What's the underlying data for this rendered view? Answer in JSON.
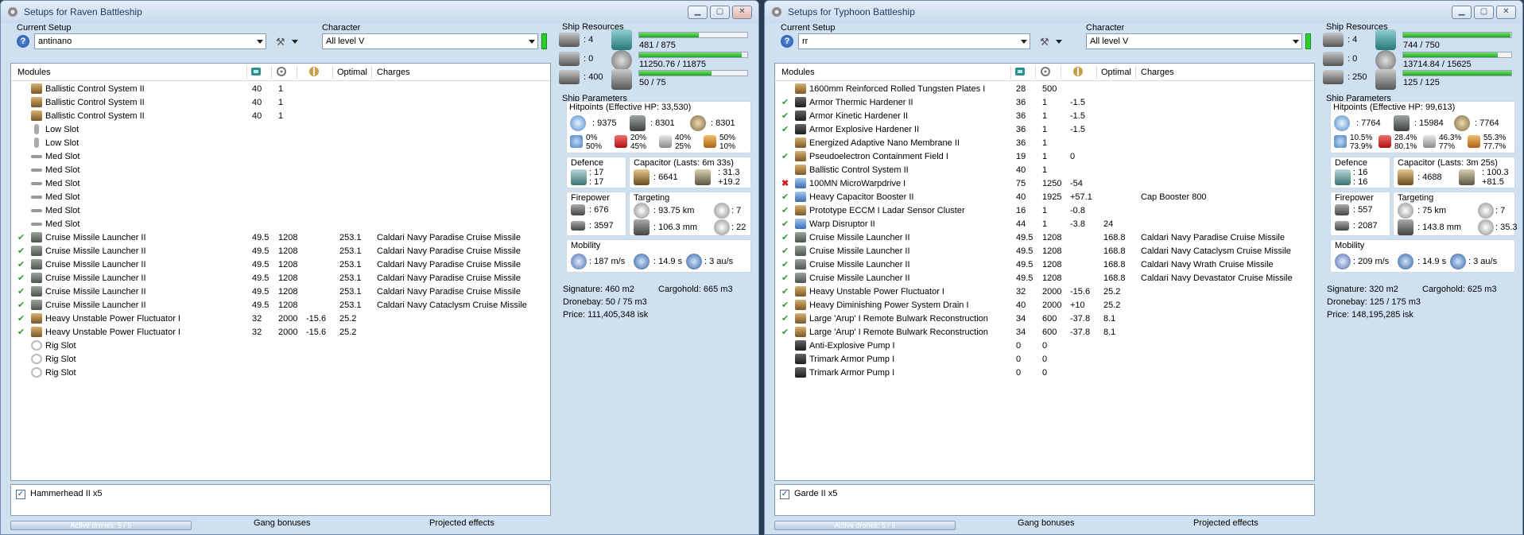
{
  "windows": [
    {
      "title": "Setups for Raven Battleship",
      "current_setup_label": "Current Setup",
      "setup_value": "antinano",
      "character_label": "Character",
      "character_value": "All level V",
      "modules_header": {
        "modules": "Modules",
        "optimal": "Optimal",
        "charges": "Charges"
      },
      "modules": [
        {
          "check": "",
          "icon": "gold",
          "name": "Ballistic Control System II",
          "c1": "40",
          "c2": "1",
          "c3": "",
          "optimal": "",
          "charges": ""
        },
        {
          "check": "",
          "icon": "gold",
          "name": "Ballistic Control System II",
          "c1": "40",
          "c2": "1",
          "c3": "",
          "optimal": "",
          "charges": ""
        },
        {
          "check": "",
          "icon": "gold",
          "name": "Ballistic Control System II",
          "c1": "40",
          "c2": "1",
          "c3": "",
          "optimal": "",
          "charges": ""
        },
        {
          "check": "",
          "icon": "low",
          "name": "Low Slot",
          "c1": "",
          "c2": "",
          "c3": "",
          "optimal": "",
          "charges": ""
        },
        {
          "check": "",
          "icon": "low",
          "name": "Low Slot",
          "c1": "",
          "c2": "",
          "c3": "",
          "optimal": "",
          "charges": ""
        },
        {
          "check": "",
          "icon": "med",
          "name": "Med Slot",
          "c1": "",
          "c2": "",
          "c3": "",
          "optimal": "",
          "charges": ""
        },
        {
          "check": "",
          "icon": "med",
          "name": "Med Slot",
          "c1": "",
          "c2": "",
          "c3": "",
          "optimal": "",
          "charges": ""
        },
        {
          "check": "",
          "icon": "med",
          "name": "Med Slot",
          "c1": "",
          "c2": "",
          "c3": "",
          "optimal": "",
          "charges": ""
        },
        {
          "check": "",
          "icon": "med",
          "name": "Med Slot",
          "c1": "",
          "c2": "",
          "c3": "",
          "optimal": "",
          "charges": ""
        },
        {
          "check": "",
          "icon": "med",
          "name": "Med Slot",
          "c1": "",
          "c2": "",
          "c3": "",
          "optimal": "",
          "charges": ""
        },
        {
          "check": "",
          "icon": "med",
          "name": "Med Slot",
          "c1": "",
          "c2": "",
          "c3": "",
          "optimal": "",
          "charges": ""
        },
        {
          "check": "✔",
          "icon": "sq",
          "name": "Cruise Missile Launcher II",
          "c1": "49.5",
          "c2": "1208",
          "c3": "",
          "optimal": "253.1",
          "charges": "Caldari Navy Paradise Cruise Missile"
        },
        {
          "check": "✔",
          "icon": "sq",
          "name": "Cruise Missile Launcher II",
          "c1": "49.5",
          "c2": "1208",
          "c3": "",
          "optimal": "253.1",
          "charges": "Caldari Navy Paradise Cruise Missile"
        },
        {
          "check": "✔",
          "icon": "sq",
          "name": "Cruise Missile Launcher II",
          "c1": "49.5",
          "c2": "1208",
          "c3": "",
          "optimal": "253.1",
          "charges": "Caldari Navy Paradise Cruise Missile"
        },
        {
          "check": "✔",
          "icon": "sq",
          "name": "Cruise Missile Launcher II",
          "c1": "49.5",
          "c2": "1208",
          "c3": "",
          "optimal": "253.1",
          "charges": "Caldari Navy Paradise Cruise Missile"
        },
        {
          "check": "✔",
          "icon": "sq",
          "name": "Cruise Missile Launcher II",
          "c1": "49.5",
          "c2": "1208",
          "c3": "",
          "optimal": "253.1",
          "charges": "Caldari Navy Paradise Cruise Missile"
        },
        {
          "check": "✔",
          "icon": "sq",
          "name": "Cruise Missile Launcher II",
          "c1": "49.5",
          "c2": "1208",
          "c3": "",
          "optimal": "253.1",
          "charges": "Caldari Navy Cataclysm Cruise Missile"
        },
        {
          "check": "✔",
          "icon": "gold",
          "name": "Heavy Unstable Power Fluctuator I",
          "c1": "32",
          "c2": "2000",
          "c3": "-15.6",
          "optimal": "25.2",
          "charges": ""
        },
        {
          "check": "✔",
          "icon": "gold",
          "name": "Heavy Unstable Power Fluctuator I",
          "c1": "32",
          "c2": "2000",
          "c3": "-15.6",
          "optimal": "25.2",
          "charges": ""
        },
        {
          "check": "",
          "icon": "rig",
          "name": "Rig Slot",
          "c1": "",
          "c2": "",
          "c3": "",
          "optimal": "",
          "charges": ""
        },
        {
          "check": "",
          "icon": "rig",
          "name": "Rig Slot",
          "c1": "",
          "c2": "",
          "c3": "",
          "optimal": "",
          "charges": ""
        },
        {
          "check": "",
          "icon": "rig",
          "name": "Rig Slot",
          "c1": "",
          "c2": "",
          "c3": "",
          "optimal": "",
          "charges": ""
        }
      ],
      "drones": "Hammerhead II x5",
      "drones_checked": true,
      "bottom_tab_1": "Active drones: 5 / 5",
      "bottom_tab_2": "Gang bonuses",
      "bottom_tab_3": "Projected effects",
      "resources_label": "Ship Resources",
      "res_turrets": "4",
      "res_launchers": "0",
      "res_calib": "400",
      "cpu": "481 / 875",
      "cpu_frac": 0.55,
      "power": "11250.76 / 11875",
      "power_frac": 0.947,
      "drone_bw": "50 / 75",
      "drone_bw_frac": 0.667,
      "params_label": "Ship Parameters",
      "ehp_label": "Hitpoints (Effective HP: 33,530)",
      "hp_shield": ": 9375",
      "hp_armor": ": 8301",
      "hp_hull": ": 8301",
      "res_em_1": "0%",
      "res_em_2": "50%",
      "res_th_1": "20%",
      "res_th_2": "45%",
      "res_ki_1": "40%",
      "res_ki_2": "25%",
      "res_ex_1": "50%",
      "res_ex_2": "10%",
      "defence_label": "Defence",
      "def_1": ": 17",
      "def_2": ": 17",
      "capacitor_label": "Capacitor (Lasts: 6m 33s)",
      "cap_amount": ": 6641",
      "cap_delta_1": ": 31.3",
      "cap_delta_2": "+19.2",
      "firepower_label": "Firepower",
      "fp_1": ": 676",
      "fp_2": ": 3597",
      "targeting_label": "Targeting",
      "tg_range": ": 93.75 km",
      "tg_res": ": 106.3 mm",
      "tg_targets": ": 7",
      "tg_scan": ": 22",
      "mobility_label": "Mobility",
      "mob_speed": ": 187 m/s",
      "mob_align": ": 14.9 s",
      "mob_warp": ": 3 au/s",
      "signature": "Signature: 460 m2",
      "cargohold": "Cargohold: 665 m3",
      "dronebay": "Dronebay: 50 / 75 m3",
      "price": "Price: 111,405,348 isk"
    },
    {
      "title": "Setups for Typhoon Battleship",
      "current_setup_label": "Current Setup",
      "setup_value": "rr",
      "character_label": "Character",
      "character_value": "All level V",
      "modules_header": {
        "modules": "Modules",
        "optimal": "Optimal",
        "charges": "Charges"
      },
      "modules": [
        {
          "check": "",
          "icon": "gold",
          "name": "1600mm Reinforced Rolled Tungsten Plates I",
          "c1": "28",
          "c2": "500",
          "c3": "",
          "optimal": "",
          "charges": ""
        },
        {
          "check": "✔",
          "icon": "dark",
          "name": "Armor Thermic Hardener II",
          "c1": "36",
          "c2": "1",
          "c3": "-1.5",
          "optimal": "",
          "charges": ""
        },
        {
          "check": "✔",
          "icon": "dark",
          "name": "Armor Kinetic Hardener II",
          "c1": "36",
          "c2": "1",
          "c3": "-1.5",
          "optimal": "",
          "charges": ""
        },
        {
          "check": "✔",
          "icon": "dark",
          "name": "Armor Explosive Hardener II",
          "c1": "36",
          "c2": "1",
          "c3": "-1.5",
          "optimal": "",
          "charges": ""
        },
        {
          "check": "",
          "icon": "gold",
          "name": "Energized Adaptive Nano Membrane II",
          "c1": "36",
          "c2": "1",
          "c3": "",
          "optimal": "",
          "charges": ""
        },
        {
          "check": "✔",
          "icon": "gold",
          "name": "Pseudoelectron Containment Field I",
          "c1": "19",
          "c2": "1",
          "c3": "0",
          "optimal": "",
          "charges": ""
        },
        {
          "check": "",
          "icon": "gold",
          "name": "Ballistic Control System II",
          "c1": "40",
          "c2": "1",
          "c3": "",
          "optimal": "",
          "charges": ""
        },
        {
          "check": "✖",
          "icon": "blue",
          "name": "100MN MicroWarpdrive I",
          "c1": "75",
          "c2": "1250",
          "c3": "-54",
          "optimal": "",
          "charges": ""
        },
        {
          "check": "✔",
          "icon": "blue",
          "name": "Heavy Capacitor Booster II",
          "c1": "40",
          "c2": "1925",
          "c3": "+57.1",
          "optimal": "",
          "charges": "Cap Booster 800"
        },
        {
          "check": "✔",
          "icon": "gold",
          "name": "Prototype ECCM I Ladar Sensor Cluster",
          "c1": "16",
          "c2": "1",
          "c3": "-0.8",
          "optimal": "",
          "charges": ""
        },
        {
          "check": "✔",
          "icon": "blue",
          "name": "Warp Disruptor II",
          "c1": "44",
          "c2": "1",
          "c3": "-3.8",
          "optimal": "24",
          "charges": ""
        },
        {
          "check": "✔",
          "icon": "sq",
          "name": "Cruise Missile Launcher II",
          "c1": "49.5",
          "c2": "1208",
          "c3": "",
          "optimal": "168.8",
          "charges": "Caldari Navy Paradise Cruise Missile"
        },
        {
          "check": "✔",
          "icon": "sq",
          "name": "Cruise Missile Launcher II",
          "c1": "49.5",
          "c2": "1208",
          "c3": "",
          "optimal": "168.8",
          "charges": "Caldari Navy Cataclysm Cruise Missile"
        },
        {
          "check": "✔",
          "icon": "sq",
          "name": "Cruise Missile Launcher II",
          "c1": "49.5",
          "c2": "1208",
          "c3": "",
          "optimal": "168.8",
          "charges": "Caldari Navy Wrath Cruise Missile"
        },
        {
          "check": "✔",
          "icon": "sq",
          "name": "Cruise Missile Launcher II",
          "c1": "49.5",
          "c2": "1208",
          "c3": "",
          "optimal": "168.8",
          "charges": "Caldari Navy Devastator Cruise Missile"
        },
        {
          "check": "✔",
          "icon": "gold",
          "name": "Heavy Unstable Power Fluctuator I",
          "c1": "32",
          "c2": "2000",
          "c3": "-15.6",
          "optimal": "25.2",
          "charges": ""
        },
        {
          "check": "✔",
          "icon": "gold",
          "name": "Heavy Diminishing Power System Drain I",
          "c1": "40",
          "c2": "2000",
          "c3": "+10",
          "optimal": "25.2",
          "charges": ""
        },
        {
          "check": "✔",
          "icon": "gold",
          "name": "Large 'Arup' I Remote Bulwark Reconstruction",
          "c1": "34",
          "c2": "600",
          "c3": "-37.8",
          "optimal": "8.1",
          "charges": ""
        },
        {
          "check": "✔",
          "icon": "gold",
          "name": "Large 'Arup' I Remote Bulwark Reconstruction",
          "c1": "34",
          "c2": "600",
          "c3": "-37.8",
          "optimal": "8.1",
          "charges": ""
        },
        {
          "check": "",
          "icon": "dark",
          "name": "Anti-Explosive Pump I",
          "c1": "0",
          "c2": "0",
          "c3": "",
          "optimal": "",
          "charges": ""
        },
        {
          "check": "",
          "icon": "dark",
          "name": "Trimark Armor Pump I",
          "c1": "0",
          "c2": "0",
          "c3": "",
          "optimal": "",
          "charges": ""
        },
        {
          "check": "",
          "icon": "dark",
          "name": "Trimark Armor Pump I",
          "c1": "0",
          "c2": "0",
          "c3": "",
          "optimal": "",
          "charges": ""
        }
      ],
      "drones": "Garde II x5",
      "drones_checked": true,
      "bottom_tab_1": "Active drones: 5 / 5",
      "bottom_tab_2": "Gang bonuses",
      "bottom_tab_3": "Projected effects",
      "resources_label": "Ship Resources",
      "res_turrets": "4",
      "res_launchers": "0",
      "res_calib": "250",
      "cpu": "744 / 750",
      "cpu_frac": 0.992,
      "power": "13714.84 / 15625",
      "power_frac": 0.878,
      "drone_bw": "125 / 125",
      "drone_bw_frac": 1.0,
      "params_label": "Ship Parameters",
      "ehp_label": "Hitpoints (Effective HP: 99,613)",
      "hp_shield": ": 7764",
      "hp_armor": ": 15984",
      "hp_hull": ": 7764",
      "res_em_1": "10.5%",
      "res_em_2": "73.9%",
      "res_th_1": "28.4%",
      "res_th_2": "80.1%",
      "res_ki_1": "46.3%",
      "res_ki_2": "77%",
      "res_ex_1": "55.3%",
      "res_ex_2": "77.7%",
      "defence_label": "Defence",
      "def_1": ": 16",
      "def_2": ": 16",
      "capacitor_label": "Capacitor (Lasts: 3m 25s)",
      "cap_amount": ": 4688",
      "cap_delta_1": ": 100.3",
      "cap_delta_2": "+81.5",
      "firepower_label": "Firepower",
      "fp_1": ": 557",
      "fp_2": ": 2087",
      "targeting_label": "Targeting",
      "tg_range": ": 75 km",
      "tg_res": ": 143.8 mm",
      "tg_targets": ": 7",
      "tg_scan": ": 35.3",
      "mobility_label": "Mobility",
      "mob_speed": ": 209 m/s",
      "mob_align": ": 14.9 s",
      "mob_warp": ": 3 au/s",
      "signature": "Signature: 320 m2",
      "cargohold": "Cargohold: 625 m3",
      "dronebay": "Dronebay: 125 / 175 m3",
      "price": "Price: 148,195,285 isk"
    }
  ]
}
